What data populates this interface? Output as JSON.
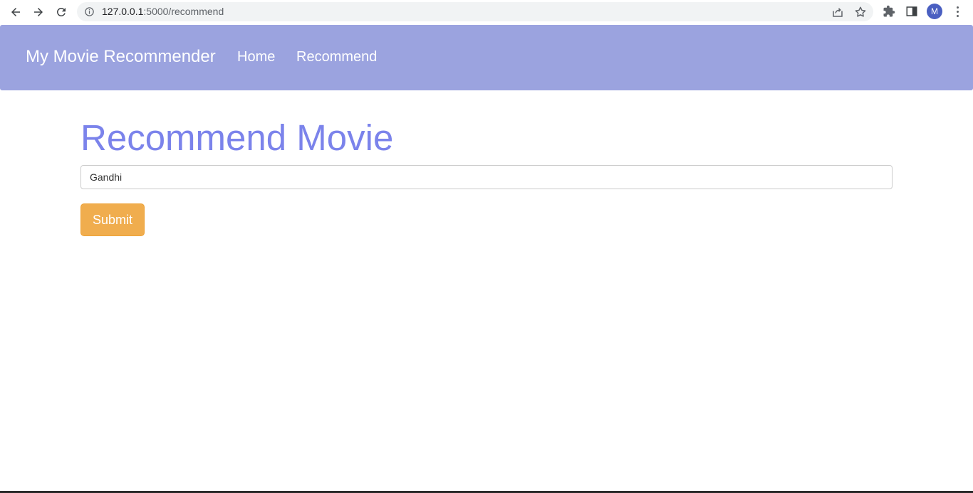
{
  "browser": {
    "url_host": "127.0.0.1",
    "url_path": ":5000/recommend",
    "profile_initial": "M",
    "icons": [
      "back-arrow-icon",
      "forward-arrow-icon",
      "reload-icon",
      "site-info-icon",
      "share-icon",
      "bookmark-star-icon",
      "extensions-icon",
      "side-panel-icon",
      "more-menu-icon"
    ]
  },
  "navbar": {
    "brand": "My Movie Recommender",
    "links": [
      "Home",
      "Recommend"
    ],
    "color": "#9ba3df"
  },
  "main": {
    "title": "Recommend Movie",
    "title_color": "#7b83eb",
    "movie_input_value": "Gandhi",
    "submit_label": "Submit",
    "submit_color": "#f0ad4e"
  }
}
